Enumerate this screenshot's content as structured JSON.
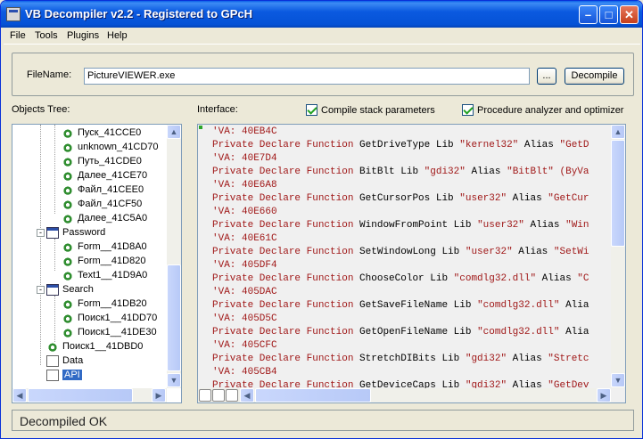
{
  "window": {
    "title": "VB Decompiler v2.2 - Registered to GPcH"
  },
  "menu": [
    "File",
    "Tools",
    "Plugins",
    "Help"
  ],
  "filename": {
    "label": "FileName:",
    "value": "PictureVIEWER.exe",
    "browse_label": "...",
    "decompile_label": "Decompile"
  },
  "tree": {
    "label": "Objects Tree:",
    "items": [
      {
        "label": "Пуск_41CCE0",
        "icon": "gear-icon"
      },
      {
        "label": "unknown_41CD70",
        "icon": "gear-icon"
      },
      {
        "label": "Путь_41CDE0",
        "icon": "gear-icon"
      },
      {
        "label": "Далее_41CE70",
        "icon": "gear-icon"
      },
      {
        "label": "Файл_41CEE0",
        "icon": "gear-icon"
      },
      {
        "label": "Файл_41CF50",
        "icon": "gear-icon"
      },
      {
        "label": "Далее_41C5A0",
        "icon": "gear-icon"
      },
      {
        "label": "Password",
        "icon": "form-icon"
      },
      {
        "label": "Form__41D8A0",
        "icon": "gear-icon"
      },
      {
        "label": "Form__41D820",
        "icon": "gear-icon"
      },
      {
        "label": "Text1__41D9A0",
        "icon": "gear-icon"
      },
      {
        "label": "Search",
        "icon": "form-icon"
      },
      {
        "label": "Form__41DB20",
        "icon": "gear-icon"
      },
      {
        "label": "Поиск1__41DD70",
        "icon": "gear-icon"
      },
      {
        "label": "Поиск1__41DE30",
        "icon": "gear-icon"
      },
      {
        "label": "Поиск1__41DBD0",
        "icon": "gear-icon"
      },
      {
        "label": "Data",
        "icon": "doc-icon"
      },
      {
        "label": "API",
        "icon": "api-icon"
      }
    ]
  },
  "interface": {
    "label": "Interface:",
    "compile_stack_label": "Compile stack parameters",
    "proc_analyzer_label": "Procedure analyzer and optimizer"
  },
  "code_lines": [
    {
      "type": "va",
      "text": "'VA: 40EB4C"
    },
    {
      "type": "decl",
      "prefix": "Private Declare Function",
      "name": " GetDriveType Lib ",
      "lib": "\"kernel32\"",
      "alias_kw": " Alias ",
      "alias": "\"GetD"
    },
    {
      "type": "va",
      "text": "'VA: 40E7D4"
    },
    {
      "type": "decl",
      "prefix": "Private Declare Function",
      "name": " BitBlt Lib ",
      "lib": "\"gdi32\"",
      "alias_kw": " Alias ",
      "alias": "\"BitBlt\" (ByVa"
    },
    {
      "type": "va",
      "text": "'VA: 40E6A8"
    },
    {
      "type": "decl",
      "prefix": "Private Declare Function",
      "name": " GetCursorPos Lib ",
      "lib": "\"user32\"",
      "alias_kw": " Alias ",
      "alias": "\"GetCur"
    },
    {
      "type": "va",
      "text": "'VA: 40E660"
    },
    {
      "type": "decl",
      "prefix": "Private Declare Function",
      "name": " WindowFromPoint Lib ",
      "lib": "\"user32\"",
      "alias_kw": " Alias ",
      "alias": "\"Win"
    },
    {
      "type": "va",
      "text": "'VA: 40E61C"
    },
    {
      "type": "decl",
      "prefix": "Private Declare Function",
      "name": " SetWindowLong Lib ",
      "lib": "\"user32\"",
      "alias_kw": " Alias ",
      "alias": "\"SetWi"
    },
    {
      "type": "va",
      "text": "'VA: 405DF4"
    },
    {
      "type": "decl",
      "prefix": "Private Declare Function",
      "name": " ChooseColor Lib ",
      "lib": "\"comdlg32.dll\"",
      "alias_kw": " Alias ",
      "alias": "\"C"
    },
    {
      "type": "va",
      "text": "'VA: 405DAC"
    },
    {
      "type": "decl",
      "prefix": "Private Declare Function",
      "name": " GetSaveFileName Lib ",
      "lib": "\"comdlg32.dll\"",
      "alias_kw": " Alia",
      "alias": ""
    },
    {
      "type": "va",
      "text": "'VA: 405D5C"
    },
    {
      "type": "decl",
      "prefix": "Private Declare Function",
      "name": " GetOpenFileName Lib ",
      "lib": "\"comdlg32.dll\"",
      "alias_kw": " Alia",
      "alias": ""
    },
    {
      "type": "va",
      "text": "'VA: 405CFC"
    },
    {
      "type": "decl",
      "prefix": "Private Declare Function",
      "name": " StretchDIBits Lib ",
      "lib": "\"gdi32\"",
      "alias_kw": " Alias ",
      "alias": "\"Stretc"
    },
    {
      "type": "va",
      "text": "'VA: 405CB4"
    },
    {
      "type": "decl",
      "prefix": "Private Declare Function",
      "name": " GetDeviceCaps Lib ",
      "lib": "\"gdi32\"",
      "alias_kw": " Alias ",
      "alias": "\"GetDev"
    }
  ],
  "status": {
    "text": "Decompiled OK"
  },
  "colors": {
    "accent": "#0552d6",
    "code_red": "#a01818"
  }
}
